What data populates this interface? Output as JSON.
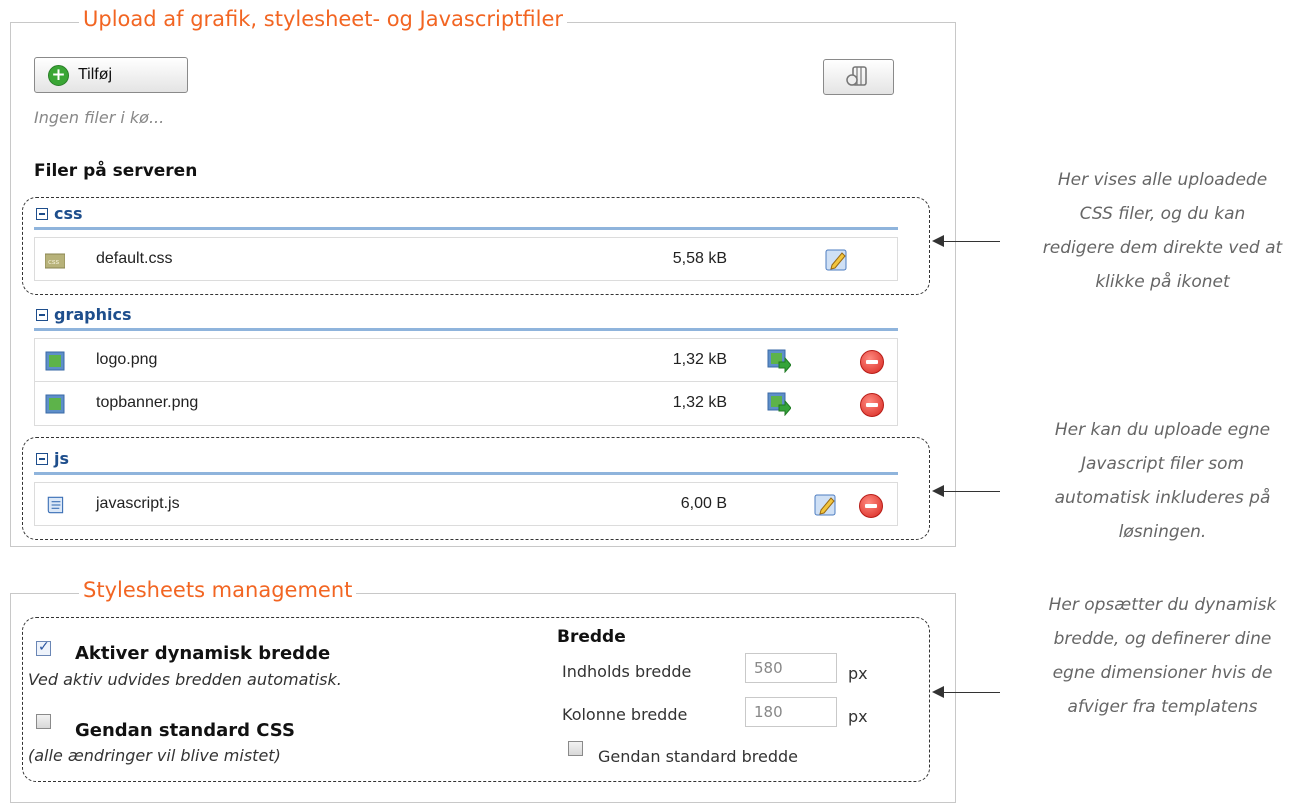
{
  "upload": {
    "legend": "Upload af grafik, stylesheet- og Javascriptfiler",
    "add_label": "Tilføj",
    "queue_status": "Ingen filer i kø...",
    "server_title": "Filer på serveren",
    "groups": [
      {
        "name": "css",
        "files": [
          {
            "name": "default.css",
            "size": "5,58 kB",
            "icon": "css-file-icon",
            "actions": [
              "edit"
            ]
          }
        ]
      },
      {
        "name": "graphics",
        "files": [
          {
            "name": "logo.png",
            "size": "1,32 kB",
            "icon": "image-file-icon",
            "actions": [
              "export",
              "delete"
            ]
          },
          {
            "name": "topbanner.png",
            "size": "1,32 kB",
            "icon": "image-file-icon",
            "actions": [
              "export",
              "delete"
            ]
          }
        ]
      },
      {
        "name": "js",
        "files": [
          {
            "name": "javascript.js",
            "size": "6,00 B",
            "icon": "script-file-icon",
            "actions": [
              "edit",
              "delete"
            ]
          }
        ]
      }
    ]
  },
  "stylesheets": {
    "legend": "Stylesheets management",
    "dynamic_width": {
      "label": "Aktiver dynamisk bredde",
      "description": "Ved aktiv udvides bredden automatisk.",
      "checked": true
    },
    "restore_css": {
      "label": "Gendan standard CSS",
      "description": "(alle ændringer vil blive mistet)",
      "checked": false
    },
    "width": {
      "title": "Bredde",
      "content_label": "Indholds bredde",
      "content_value": "580",
      "column_label": "Kolonne bredde",
      "column_value": "180",
      "unit": "px",
      "restore_label": "Gendan standard bredde",
      "restore_checked": false
    }
  },
  "annotations": [
    [
      "Her vises alle uploadede",
      "CSS filer, og du kan",
      "redigere dem direkte ved at",
      "klikke på ikonet"
    ],
    [
      "Her kan du uploade egne",
      "Javascript filer som",
      "automatisk inkluderes på",
      "løsningen."
    ],
    [
      "Her opsætter du dynamisk",
      "bredde, og definerer dine",
      "egne dimensioner hvis de",
      "afviger fra templatens"
    ]
  ],
  "colors": {
    "legend": "#f26522",
    "group_head": "#1e4e8c",
    "group_rule": "#8fb4dc",
    "annotation": "#666666"
  }
}
